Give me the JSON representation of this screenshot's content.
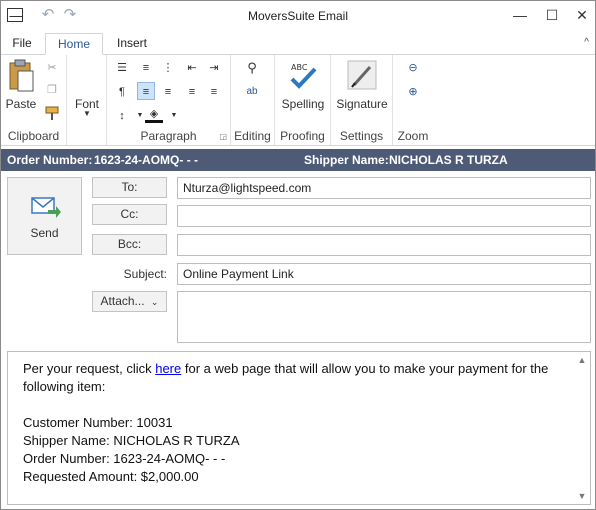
{
  "window": {
    "title": "MoversSuite Email",
    "controls": {
      "minimize": "—",
      "maximize": "☐",
      "close": "✕"
    }
  },
  "ribbon": {
    "tabs": [
      {
        "label": "File",
        "active": false
      },
      {
        "label": "Home",
        "active": true
      },
      {
        "label": "Insert",
        "active": false
      }
    ],
    "collapse_glyph": "^",
    "groups": {
      "clipboard": {
        "label": "Clipboard",
        "paste_label": "Paste"
      },
      "font": {
        "label": "Font"
      },
      "paragraph": {
        "label": "Paragraph"
      },
      "editing": {
        "label": "Editing"
      },
      "proofing": {
        "label": "Proofing",
        "spelling_label": "Spelling"
      },
      "settings": {
        "label": "Settings",
        "signature_label": "Signature"
      },
      "zoom": {
        "label": "Zoom"
      }
    }
  },
  "info_bar": {
    "order_label": "Order Number:",
    "order_value": "1623-24-AOMQ- - -",
    "shipper_label": "Shipper Name:",
    "shipper_value": "NICHOLAS R TURZA"
  },
  "compose": {
    "send_label": "Send",
    "to_label": "To:",
    "to_value": "Nturza@lightspeed.com",
    "cc_label": "Cc:",
    "cc_value": "",
    "bcc_label": "Bcc:",
    "bcc_value": "",
    "subject_label": "Subject:",
    "subject_value": "Online Payment Link",
    "attach_label": "Attach..."
  },
  "body": {
    "intro_before_link": "Per your request, click ",
    "link_text": "here",
    "intro_after_link": " for a web page that will allow you to make your payment for the following item:",
    "lines": [
      "Customer Number: 10031",
      "Shipper Name: NICHOLAS R TURZA",
      "Order Number: 1623-24-AOMQ- - -",
      "Requested Amount: $2,000.00"
    ]
  },
  "colors": {
    "info_bar_bg": "#4e5b77",
    "accent": "#2b579a",
    "selected_toggle": "#cde3f7"
  }
}
